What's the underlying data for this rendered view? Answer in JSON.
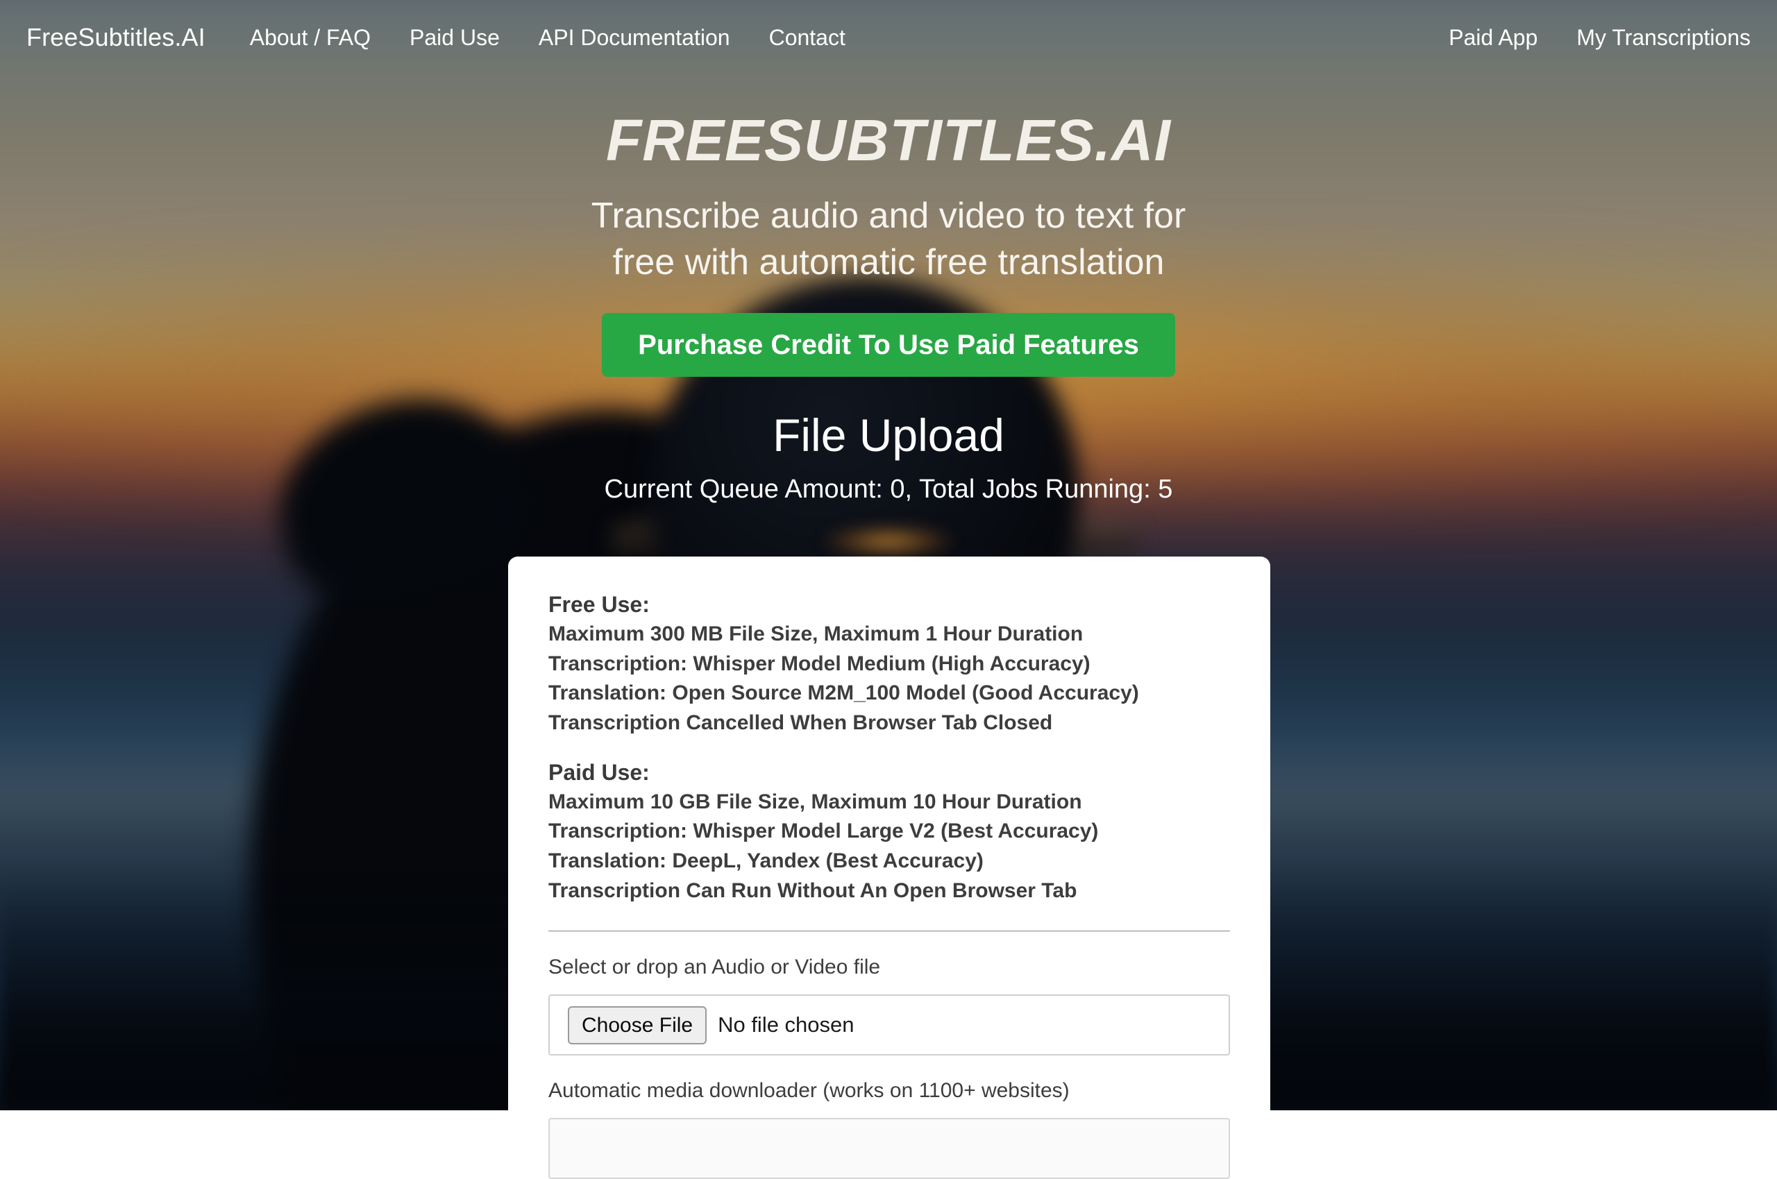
{
  "navbar": {
    "brand": "FreeSubtitles.AI",
    "left_links": [
      {
        "label": "About / FAQ"
      },
      {
        "label": "Paid Use"
      },
      {
        "label": "API Documentation"
      },
      {
        "label": "Contact"
      }
    ],
    "right_links": [
      {
        "label": "Paid App"
      },
      {
        "label": "My Transcriptions"
      }
    ]
  },
  "hero": {
    "title": "FREESUBTITLES.AI",
    "subtitle_line1": "Transcribe audio and video to text for",
    "subtitle_line2": "free with automatic free translation"
  },
  "cta": {
    "label": "Purchase Credit To Use Paid Features",
    "color": "#28a745"
  },
  "upload": {
    "heading": "File Upload",
    "status": "Current Queue Amount: 0, Total Jobs Running: 5"
  },
  "card": {
    "free": {
      "heading": "Free Use:",
      "lines": [
        "Maximum 300 MB File Size, Maximum 1 Hour Duration",
        "Transcription: Whisper Model Medium (High Accuracy)",
        "Translation: Open Source M2M_100 Model (Good Accuracy)",
        "Transcription Cancelled When Browser Tab Closed"
      ]
    },
    "paid": {
      "heading": "Paid Use:",
      "lines": [
        "Maximum 10 GB File Size, Maximum 10 Hour Duration",
        "Transcription: Whisper Model Large V2 (Best Accuracy)",
        "Translation: DeepL, Yandex (Best Accuracy)",
        "Transcription Can Run Without An Open Browser Tab"
      ]
    },
    "file_field": {
      "label": "Select or drop an Audio or Video file",
      "button_label": "Choose File",
      "status_text": "No file chosen"
    },
    "url_field": {
      "label": "Automatic media downloader (works on 1100+ websites)",
      "value": "",
      "placeholder": ""
    }
  }
}
